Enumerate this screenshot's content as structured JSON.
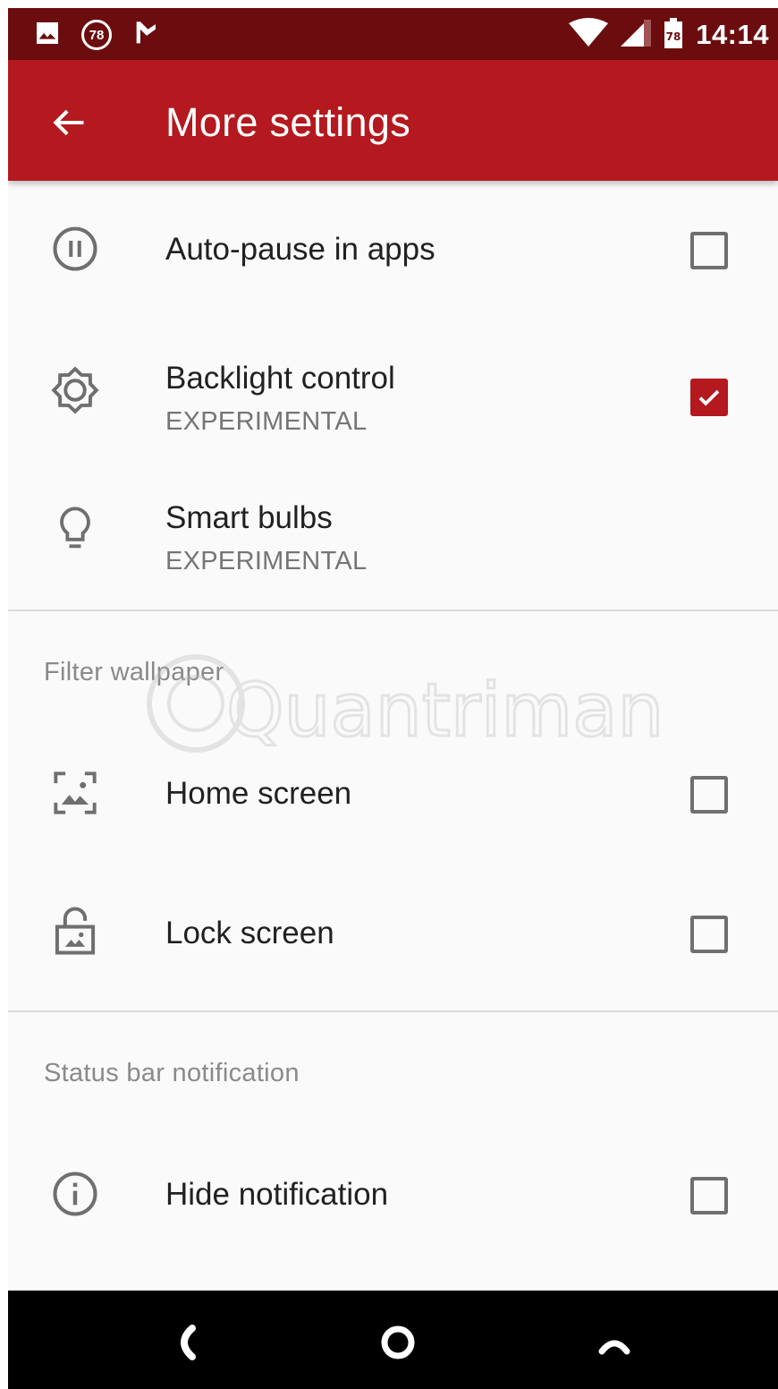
{
  "status_bar": {
    "badge_count": "78",
    "time": "14:14",
    "icons": [
      "image-icon",
      "badge-78-icon",
      "check-flag-icon",
      "wifi-icon",
      "signal-icon",
      "battery-icon"
    ]
  },
  "app_bar": {
    "title": "More settings",
    "back_icon": "arrow-left-icon",
    "color": "#b3191e"
  },
  "items": [
    {
      "icon": "pause-circle-icon",
      "title": "Auto-pause in apps",
      "subtitle": "",
      "checked": false
    },
    {
      "icon": "brightness-icon",
      "title": "Backlight control",
      "subtitle": "EXPERIMENTAL",
      "checked": true
    },
    {
      "icon": "lightbulb-icon",
      "title": "Smart bulbs",
      "subtitle": "EXPERIMENTAL"
    }
  ],
  "sections": {
    "wallpaper": {
      "header": "Filter wallpaper",
      "items": [
        {
          "icon": "wallpaper-icon",
          "title": "Home screen",
          "checked": false
        },
        {
          "icon": "lock-wallpaper-icon",
          "title": "Lock screen",
          "checked": false
        }
      ]
    },
    "notification": {
      "header": "Status bar notification",
      "items": [
        {
          "icon": "info-icon",
          "title": "Hide notification",
          "checked": false
        }
      ]
    }
  },
  "watermark": "Quantrimang",
  "nav_bar": {
    "icons": [
      "back-nav-icon",
      "home-nav-icon",
      "recents-nav-icon"
    ]
  },
  "colors": {
    "status_bar": "#6b0d0f",
    "accent": "#b3191e",
    "background": "#fafafa"
  }
}
